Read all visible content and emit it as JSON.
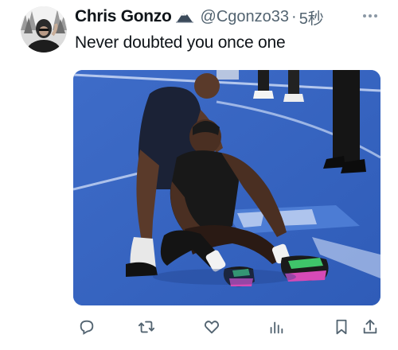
{
  "tweet": {
    "display_name": "Chris Gonzo",
    "handle": "@Cgonzo33",
    "separator": "·",
    "time": "5秒",
    "text": "Never doubted you once one"
  },
  "icons": {
    "more": "more-horizontal-icon",
    "reply": "reply-icon",
    "retweet": "retweet-icon",
    "like": "heart-icon",
    "views": "views-bar-chart-icon",
    "bookmark": "bookmark-icon",
    "share": "share-icon"
  },
  "colors": {
    "text": "#0f1419",
    "secondary": "#536471",
    "court_blue": "#3a66c4"
  }
}
